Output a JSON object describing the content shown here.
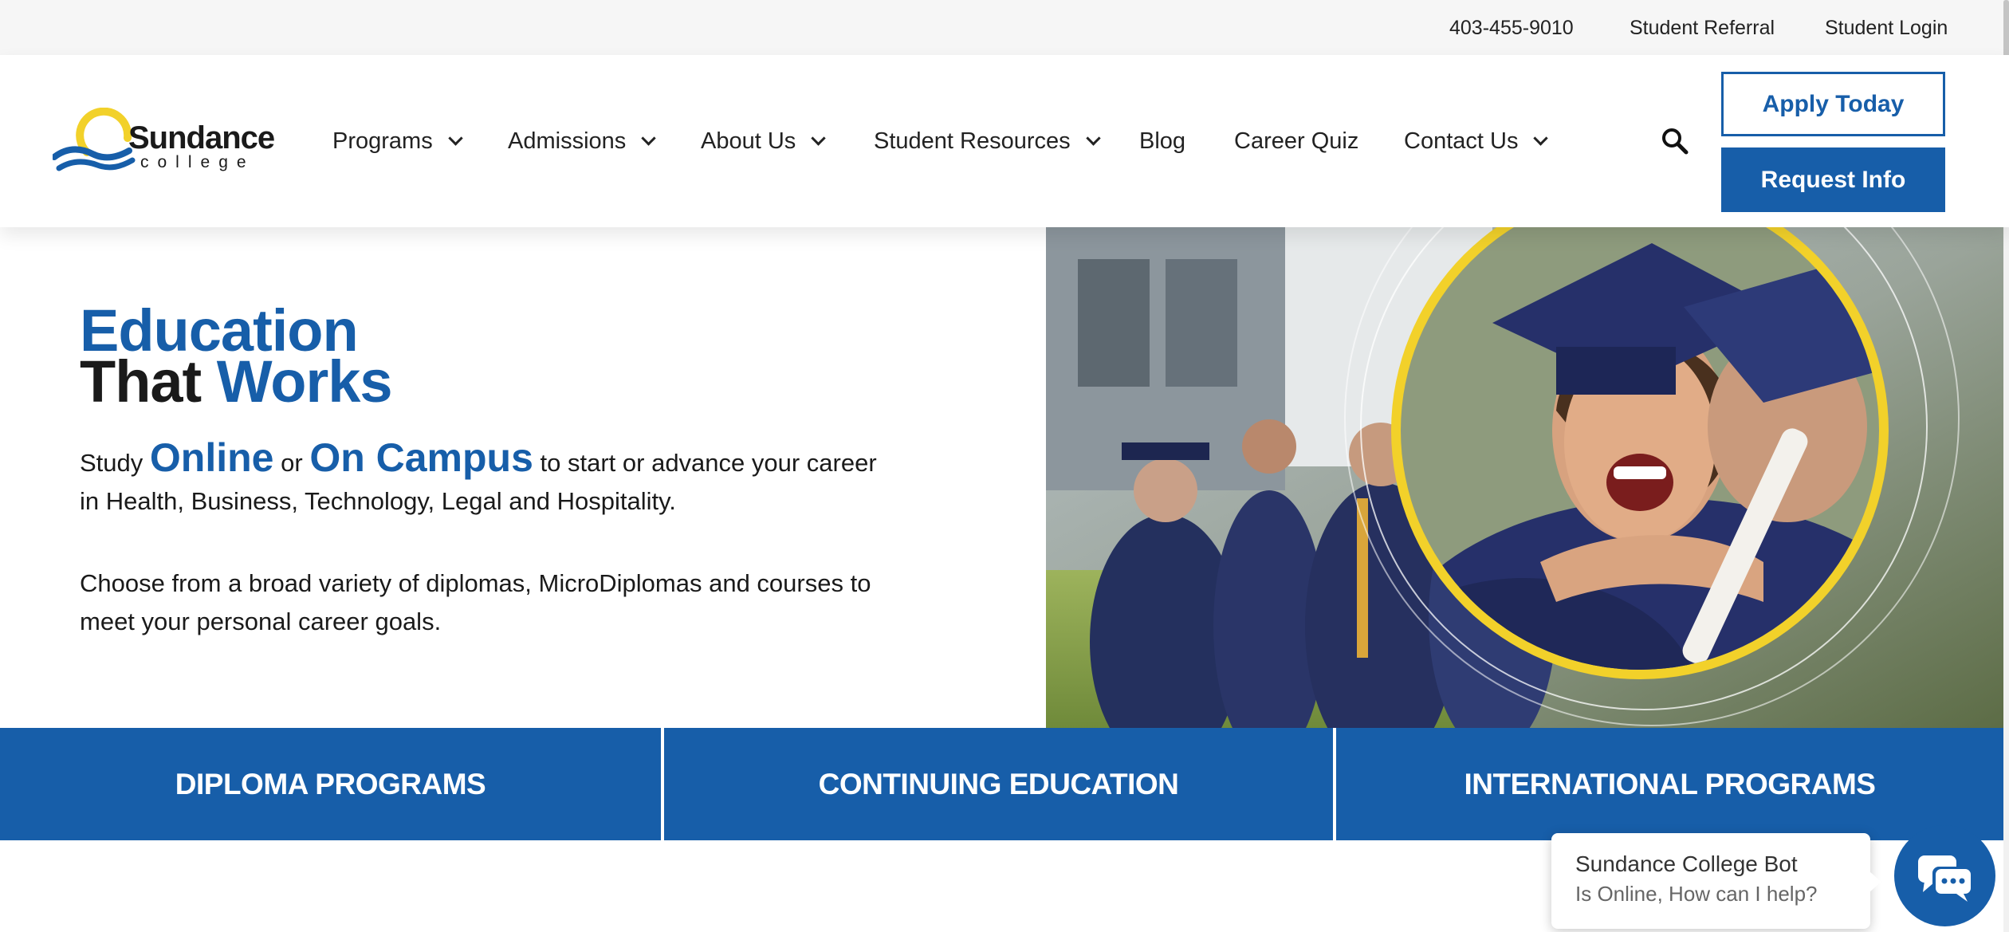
{
  "topbar": {
    "phone": "403-455-9010",
    "referral": "Student Referral",
    "login": "Student Login"
  },
  "brand": {
    "name": "Sundance",
    "sub": "college",
    "colors": {
      "primary": "#175ea9",
      "accent": "#f2d12a"
    }
  },
  "nav": {
    "items": [
      {
        "label": "Programs",
        "dropdown": true
      },
      {
        "label": "Admissions",
        "dropdown": true
      },
      {
        "label": "About Us",
        "dropdown": true
      },
      {
        "label": "Student Resources",
        "dropdown": true
      },
      {
        "label": "Blog",
        "dropdown": false
      },
      {
        "label": "Career Quiz",
        "dropdown": false
      },
      {
        "label": "Contact Us",
        "dropdown": true
      }
    ],
    "search_icon": "search-icon"
  },
  "cta": {
    "apply": "Apply Today",
    "request": "Request Info"
  },
  "hero": {
    "title_line1": "Education",
    "title_that": "That",
    "title_works": "Works",
    "p1_study": "Study",
    "p1_online": "Online",
    "p1_or": "or",
    "p1_campus": "On Campus",
    "p1_rest": "to start or advance your career in Health, Business, Technology, Legal and Hospitality.",
    "p2": "Choose from a broad variety of diplomas, MicroDiplomas and courses to meet your personal career goals."
  },
  "tiles": [
    "DIPLOMA PROGRAMS",
    "CONTINUING EDUCATION",
    "INTERNATIONAL PROGRAMS"
  ],
  "chat": {
    "name": "Sundance College Bot",
    "status": "Is Online, How can I help?",
    "icon": "chat-bubbles-icon"
  }
}
